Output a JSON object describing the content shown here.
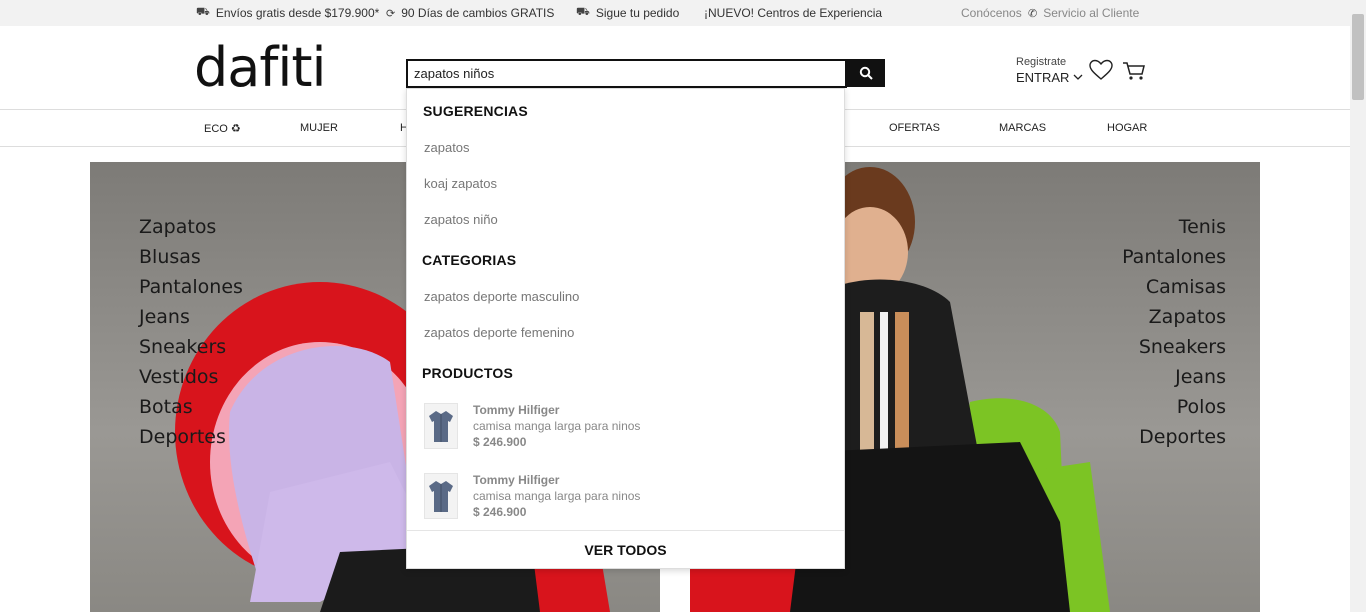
{
  "topbar": {
    "shipping": "Envíos gratis desde $179.900*",
    "returns": "90 Días de cambios GRATIS",
    "tracking": "Sigue tu pedido",
    "experience": "¡NUEVO! Centros de Experiencia",
    "about": "Conócenos",
    "support": "Servicio al Cliente"
  },
  "header": {
    "logo": "dafiti",
    "search_value": "zapatos niños",
    "register": "Registrate",
    "login": "ENTRAR"
  },
  "nav": {
    "items": [
      "ECO ♻",
      "MUJER",
      "H",
      "OFERTAS",
      "MARCAS",
      "HOGAR"
    ]
  },
  "hero": {
    "left_categories": [
      "Zapatos",
      "Blusas",
      "Pantalones",
      "Jeans",
      "Sneakers",
      "Vestidos",
      "Botas",
      "Deportes"
    ],
    "right_categories": [
      "Tenis",
      "Pantalones",
      "Camisas",
      "Zapatos",
      "Sneakers",
      "Jeans",
      "Polos",
      "Deportes"
    ]
  },
  "dropdown": {
    "suggestions_title": "SUGERENCIAS",
    "suggestions": [
      "zapatos",
      "koaj zapatos",
      "zapatos niño"
    ],
    "categories_title": "CATEGORIAS",
    "categories": [
      "zapatos deporte masculino",
      "zapatos deporte femenino"
    ],
    "products_title": "PRODUCTOS",
    "products": [
      {
        "brand": "Tommy Hilfiger",
        "name": "camisa manga larga para ninos",
        "price": "$ 246.900"
      },
      {
        "brand": "Tommy Hilfiger",
        "name": "camisa manga larga para ninos",
        "price": "$ 246.900"
      }
    ],
    "see_all": "VER TODOS"
  },
  "colors": {
    "topbar_bg": "#f2f2f2",
    "accent": "#111111",
    "muted_text": "#777777"
  }
}
